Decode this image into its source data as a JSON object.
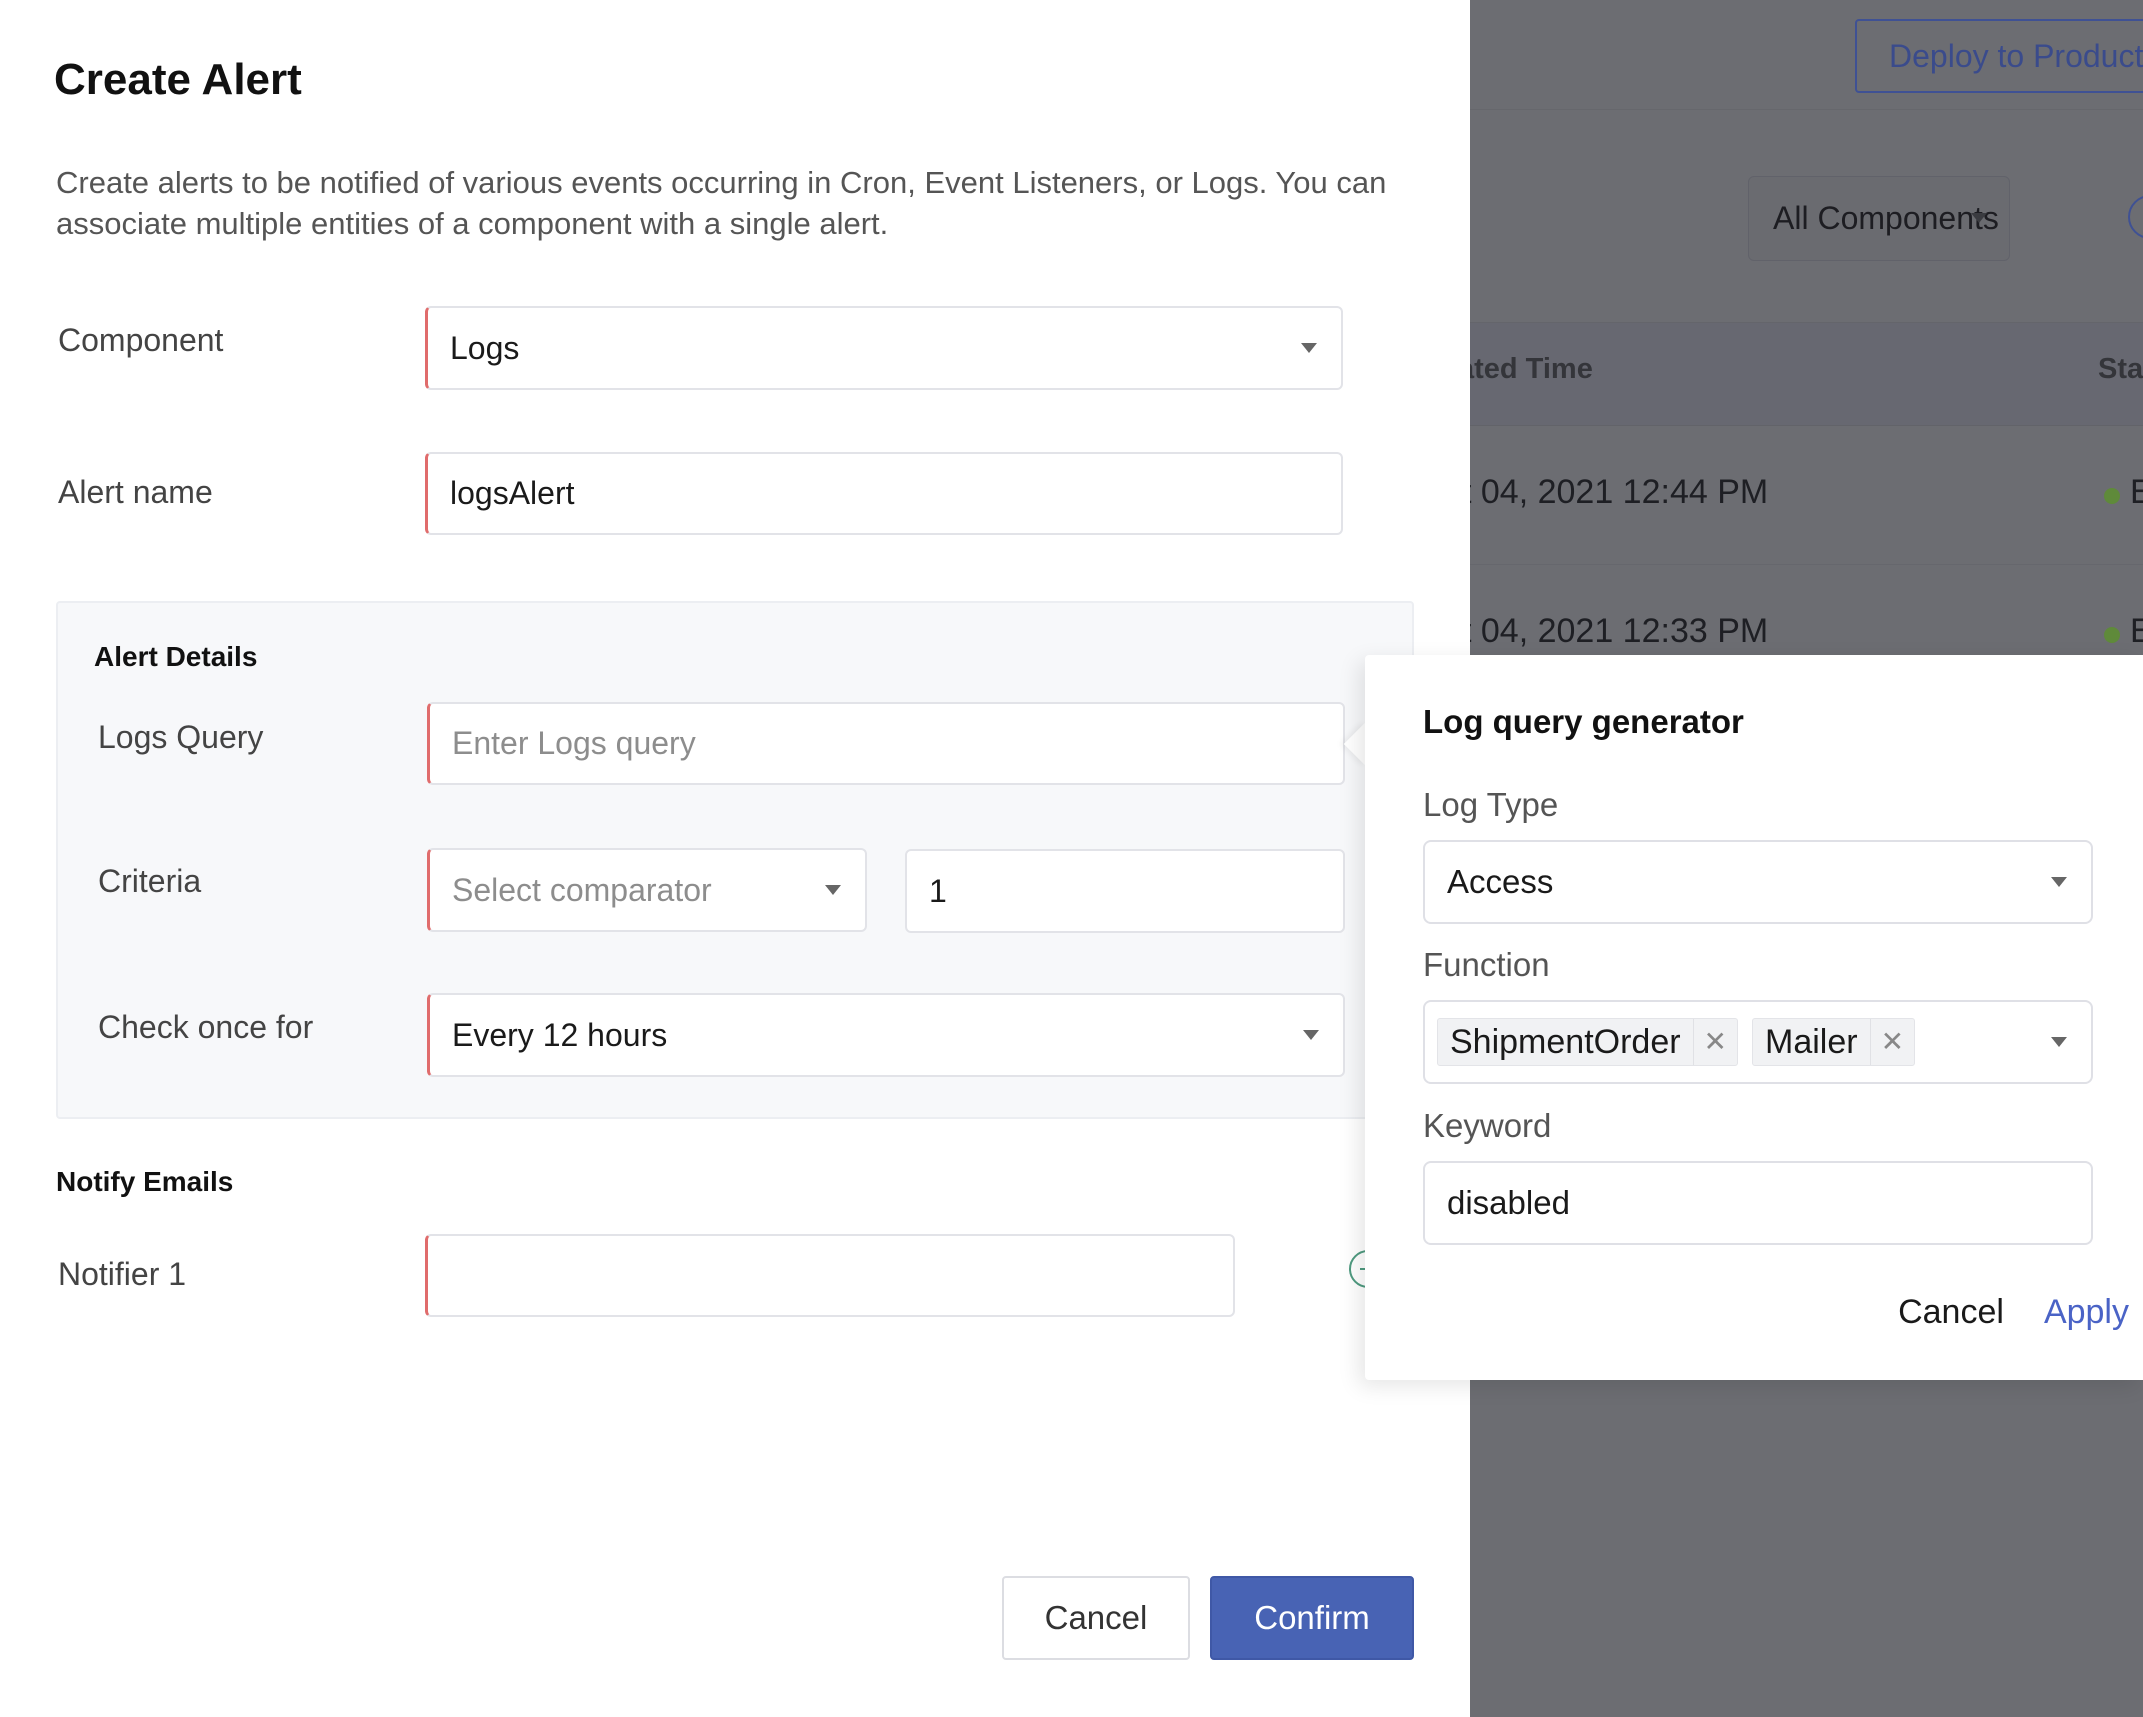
{
  "background": {
    "deploy_button": "Deploy to Production",
    "components_filter": "All Components",
    "table": {
      "headers": [
        "Last Updated Time",
        "Status"
      ],
      "header_visible": [
        "ated Time",
        "Sta"
      ],
      "rows": [
        {
          "time": "t 04, 2021 12:44 PM",
          "status": "E"
        },
        {
          "time": "t 04, 2021 12:33 PM",
          "status": "E"
        }
      ],
      "status_color": "#5f8a3a"
    }
  },
  "modal": {
    "title": "Create Alert",
    "description": "Create alerts to be notified of various events occurring in Cron, Event Listeners, or Logs. You can associate multiple entities of a component with a single alert.",
    "component": {
      "label": "Component",
      "value": "Logs"
    },
    "alert_name": {
      "label": "Alert name",
      "value": "logsAlert"
    },
    "alert_details": {
      "title": "Alert Details",
      "logs_query": {
        "label": "Logs Query",
        "value": "",
        "placeholder": "Enter Logs query"
      },
      "criteria": {
        "label": "Criteria",
        "comparator_placeholder": "Select comparator",
        "value": "1"
      },
      "check_once_for": {
        "label": "Check once for",
        "value": "Every 12 hours"
      }
    },
    "notify_emails": {
      "title": "Notify Emails",
      "notifiers": [
        {
          "label": "Notifier 1",
          "value": ""
        }
      ]
    },
    "footer": {
      "cancel_label": "Cancel",
      "confirm_label": "Confirm"
    },
    "accent_color": "#4863b4",
    "required_marker_color": "#e06c6c"
  },
  "log_query_generator": {
    "title": "Log query generator",
    "log_type": {
      "label": "Log Type",
      "value": "Access"
    },
    "function": {
      "label": "Function",
      "selected": [
        "ShipmentOrder",
        "Mailer"
      ]
    },
    "keyword": {
      "label": "Keyword",
      "value": "disabled"
    },
    "cancel_label": "Cancel",
    "apply_label": "Apply",
    "apply_color": "#4a63c6"
  }
}
